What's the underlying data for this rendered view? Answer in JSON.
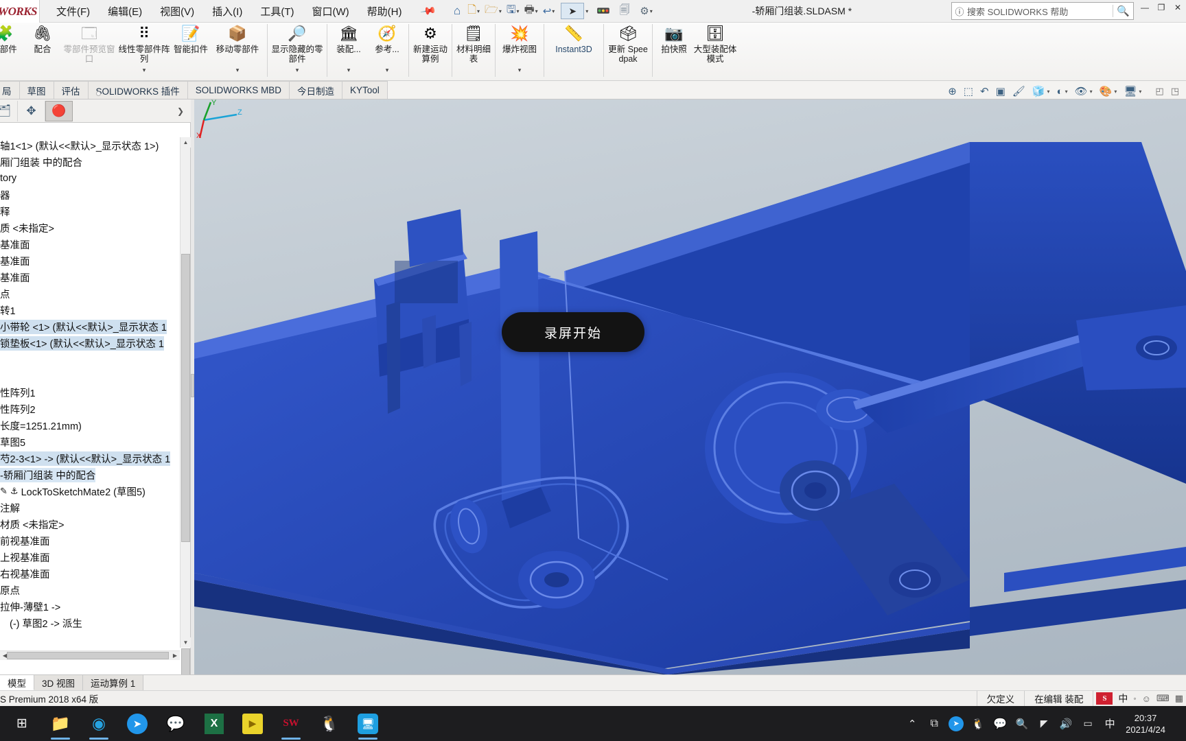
{
  "titlebar": {
    "logo": "WORKS",
    "menu": [
      {
        "label": "文件(F)",
        "name": "menu-file"
      },
      {
        "label": "编辑(E)",
        "name": "menu-edit"
      },
      {
        "label": "视图(V)",
        "name": "menu-view"
      },
      {
        "label": "插入(I)",
        "name": "menu-insert"
      },
      {
        "label": "工具(T)",
        "name": "menu-tools"
      },
      {
        "label": "窗口(W)",
        "name": "menu-window"
      },
      {
        "label": "帮助(H)",
        "name": "menu-help"
      }
    ],
    "pin_icon": "pin-icon",
    "document_title": "-轿厢门组装.SLDASM *",
    "search": {
      "prefix": "搜索",
      "suffix": "SOLIDWORKS 帮助",
      "placeholder": "搜索 SOLIDWORKS 帮助",
      "help_icon": "question-circle-icon",
      "search_icon": "magnifier-icon"
    },
    "window_buttons": [
      "minimize",
      "restore",
      "close"
    ]
  },
  "quickbar": [
    {
      "name": "home-icon",
      "glyph": "⌂"
    },
    {
      "name": "new-document-icon",
      "glyph": "🗋"
    },
    {
      "name": "open-document-icon",
      "glyph": "🗁"
    },
    {
      "name": "save-icon",
      "glyph": "🖫"
    },
    {
      "name": "print-icon",
      "glyph": "🖶"
    },
    {
      "name": "undo-icon",
      "glyph": "↩"
    },
    {
      "name": "select-arrow-icon",
      "glyph": "➤"
    },
    {
      "name": "rebuild-icon",
      "glyph": "🚦"
    },
    {
      "name": "drawing-icon",
      "glyph": "🗐"
    },
    {
      "name": "options-gear-icon",
      "glyph": "⚙"
    }
  ],
  "ribbon": {
    "buttons": [
      {
        "name": "ribbon-insert-component",
        "label": "零部件",
        "glyph": "📎",
        "caret": false,
        "dim": false,
        "clipped": true
      },
      {
        "name": "ribbon-mate",
        "label": "配合",
        "glyph": "🖇",
        "caret": false,
        "dim": false
      },
      {
        "name": "ribbon-component-preview-window",
        "label": "零部件预览窗口",
        "glyph": "🗔",
        "caret": false,
        "dim": true
      },
      {
        "name": "ribbon-linear-component-pattern",
        "label": "线性零部件阵列",
        "glyph": "⛶",
        "caret": true,
        "dim": false
      },
      {
        "name": "ribbon-smart-fasteners",
        "label": "智能扣件",
        "glyph": "📝",
        "caret": false,
        "dim": false
      },
      {
        "name": "ribbon-move-component",
        "label": "移动零部件",
        "glyph": "📦",
        "caret": true,
        "dim": false
      },
      {
        "name": "ribbon-show-hidden-components",
        "label": "显示隐藏的零部件",
        "glyph": "🔍",
        "caret": true,
        "dim": false
      },
      {
        "name": "ribbon-assembly-features",
        "label": "装配...",
        "glyph": "🏛",
        "caret": true,
        "dim": false
      },
      {
        "name": "ribbon-reference-geometry",
        "label": "参考...",
        "glyph": "🧭",
        "caret": true,
        "dim": false
      },
      {
        "name": "ribbon-new-motion-study",
        "label": "新建运动算例",
        "glyph": "⚙",
        "caret": false,
        "dim": false
      },
      {
        "name": "ribbon-bill-of-materials",
        "label": "材料明细表",
        "glyph": "📊",
        "caret": false,
        "dim": false
      },
      {
        "name": "ribbon-exploded-view",
        "label": "爆炸视图",
        "glyph": "💥",
        "caret": true,
        "dim": false
      },
      {
        "name": "ribbon-instant3d",
        "label": "Instant3D",
        "glyph": "↘",
        "caret": false,
        "dim": false,
        "latin": true
      },
      {
        "name": "ribbon-update-speedpak",
        "label": "更新 Speedpak",
        "glyph": "📦",
        "caret": false,
        "dim": false
      },
      {
        "name": "ribbon-take-snapshot",
        "label": "拍快照",
        "glyph": "📷",
        "caret": false,
        "dim": false
      },
      {
        "name": "ribbon-large-assembly-mode",
        "label": "大型装配体模式",
        "glyph": "🗄",
        "caret": false,
        "dim": false
      }
    ]
  },
  "command_tabs": [
    {
      "label": "局",
      "name": "tab-layout",
      "clipped": true
    },
    {
      "label": "草图",
      "name": "tab-sketch"
    },
    {
      "label": "评估",
      "name": "tab-evaluate"
    },
    {
      "label": "SOLIDWORKS 插件",
      "name": "tab-solidworks-addins"
    },
    {
      "label": "SOLIDWORKS MBD",
      "name": "tab-solidworks-mbd"
    },
    {
      "label": "今日制造",
      "name": "tab-manufacture-today"
    },
    {
      "label": "KYTool",
      "name": "tab-kytool"
    }
  ],
  "heads_up_view_toolbar": [
    {
      "name": "zoom-to-fit-icon",
      "glyph": "⊕"
    },
    {
      "name": "zoom-to-area-icon",
      "glyph": "⬚"
    },
    {
      "name": "previous-view-icon",
      "glyph": "↺"
    },
    {
      "name": "section-view-icon",
      "glyph": "▣"
    },
    {
      "name": "view-orientation-icon",
      "glyph": "◆"
    },
    {
      "name": "display-style-icon",
      "glyph": "▥"
    },
    {
      "name": "hide-show-items-icon",
      "glyph": "👁"
    },
    {
      "name": "edit-appearance-icon",
      "glyph": "🎨"
    },
    {
      "name": "apply-scene-icon",
      "glyph": "🖼"
    },
    {
      "name": "view-settings-icon",
      "glyph": "🖥"
    }
  ],
  "feature_manager": {
    "tabs": [
      {
        "name": "feature-tree-tab",
        "glyph": "🗂",
        "active": false
      },
      {
        "name": "property-manager-tab",
        "glyph": "✥",
        "active": false
      },
      {
        "name": "display-manager-tab",
        "glyph": "◓",
        "active": true
      }
    ],
    "expand_arrow": "chevron-right-icon",
    "rows": [
      {
        "text": "轴1<1> (默认<<默认>_显示状态 1>)",
        "name": "tree-item-shaft1"
      },
      {
        "text": "厢门组装 中的配合",
        "name": "tree-item-mates-in-assembly"
      },
      {
        "text": "tory",
        "name": "tree-item-history",
        "latin": true
      },
      {
        "text": "器",
        "name": "tree-item-sensors"
      },
      {
        "text": "释",
        "name": "tree-item-annotations"
      },
      {
        "text": "质 <未指定>",
        "name": "tree-item-material"
      },
      {
        "text": "基准面",
        "name": "tree-item-front-plane"
      },
      {
        "text": "基准面",
        "name": "tree-item-top-plane"
      },
      {
        "text": "基准面",
        "name": "tree-item-right-plane"
      },
      {
        "text": "点",
        "name": "tree-item-origin"
      },
      {
        "text": "转1",
        "name": "tree-item-revolve1"
      },
      {
        "text": "小带轮 <1> (默认<<默认>_显示状态 1",
        "name": "tree-item-small-pulley",
        "highlight": "a"
      },
      {
        "text": "锁垫板<1> (默认<<默认>_显示状态 1",
        "name": "tree-item-lock-plate",
        "highlight": "a"
      },
      {
        "text": "",
        "name": "tree-item-blank-1"
      },
      {
        "text": "",
        "name": "tree-item-blank-2"
      },
      {
        "text": "性阵列1",
        "name": "tree-item-linear-pattern1"
      },
      {
        "text": "性阵列2",
        "name": "tree-item-linear-pattern2"
      },
      {
        "text": "长度=1251.21mm)",
        "name": "tree-item-belt-length"
      },
      {
        "text": "草图5",
        "name": "tree-item-sketch5"
      },
      {
        "text": "芍2-3<1> -> (默认<<默认>_显示状态 1",
        "name": "tree-item-part2-3",
        "highlight": "a"
      },
      {
        "text": "-轿厢门组装 中的配合",
        "name": "tree-item-mates-in-door-assembly",
        "highlight": "b"
      },
      {
        "text": "LockToSketchMate2 (草图5)",
        "name": "tree-item-locktosketchmate2",
        "icons": "pencil-lock-icon",
        "indent": true
      },
      {
        "text": "注解",
        "name": "tree-item-annotations-2"
      },
      {
        "text": "材质 <未指定>",
        "name": "tree-item-material-2"
      },
      {
        "text": "前视基准面",
        "name": "tree-item-front-plane-2"
      },
      {
        "text": "上视基准面",
        "name": "tree-item-top-plane-2"
      },
      {
        "text": "右视基准面",
        "name": "tree-item-right-plane-2"
      },
      {
        "text": "原点",
        "name": "tree-item-origin-2"
      },
      {
        "text": "拉伸-薄壁1 ->",
        "name": "tree-item-extrude-thin1"
      },
      {
        "text": "(-) 草图2 -> 派生",
        "name": "tree-item-sketch2-derived",
        "indent": true
      }
    ]
  },
  "viewport": {
    "toast": "录屏开始",
    "triad_labels": {
      "x": "X",
      "y": "Y",
      "z": "Z"
    },
    "model_color": "#1b3fae",
    "background_top": "#cdd5dc",
    "background_bottom": "#aab6c1"
  },
  "bottom_tabs": [
    {
      "label": "模型",
      "name": "tab-model",
      "active": true
    },
    {
      "label": "3D 视图",
      "name": "tab-3d-views",
      "active": false
    },
    {
      "label": "运动算例 1",
      "name": "tab-motion-study-1",
      "active": false
    }
  ],
  "statusbar": {
    "left_text": "S Premium 2018 x64 版",
    "cells": [
      {
        "label": "欠定义",
        "name": "status-underdefined"
      },
      {
        "label": "在编辑 装配",
        "name": "status-editing-assembly",
        "clipped": true
      }
    ],
    "ime": {
      "switch": "S",
      "mode": "中",
      "glyphs": [
        "◦",
        "☺",
        "⌨"
      ]
    }
  },
  "taskbar": {
    "items": [
      {
        "name": "taskbar-start-icon",
        "glyph": "⊞",
        "running": false
      },
      {
        "name": "taskbar-file-explorer",
        "glyph": "📁",
        "running": true
      },
      {
        "name": "taskbar-microsoft-edge",
        "glyph": "◉",
        "running": true
      },
      {
        "name": "taskbar-foxmail",
        "glyph": "➤",
        "running": false
      },
      {
        "name": "taskbar-wechat",
        "glyph": "💬",
        "running": false
      },
      {
        "name": "taskbar-excel",
        "glyph": "X",
        "running": false
      },
      {
        "name": "taskbar-media-player",
        "glyph": "▶",
        "running": false
      },
      {
        "name": "taskbar-solidworks-2018",
        "glyph": "SW",
        "running": true
      },
      {
        "name": "taskbar-qq",
        "glyph": "🐧",
        "running": false
      },
      {
        "name": "taskbar-screen-recorder",
        "glyph": "🖥",
        "running": true
      }
    ],
    "tray": [
      {
        "name": "tray-show-hidden-icons",
        "glyph": "^"
      },
      {
        "name": "tray-screen-capture-icon",
        "glyph": "⧉"
      },
      {
        "name": "tray-foxmail-icon",
        "glyph": "➤"
      },
      {
        "name": "tray-qq-icon",
        "glyph": "🐧"
      },
      {
        "name": "tray-wechat-icon",
        "glyph": "💬"
      },
      {
        "name": "tray-search-tool-icon",
        "glyph": "🔍"
      },
      {
        "name": "tray-wifi-icon",
        "glyph": "📶"
      },
      {
        "name": "tray-volume-icon",
        "glyph": "🔊"
      },
      {
        "name": "tray-battery-icon",
        "glyph": "🔋"
      },
      {
        "name": "tray-ime-icon",
        "glyph": "中"
      }
    ],
    "clock": {
      "time": "20:37",
      "date": "2021/4/24"
    }
  }
}
